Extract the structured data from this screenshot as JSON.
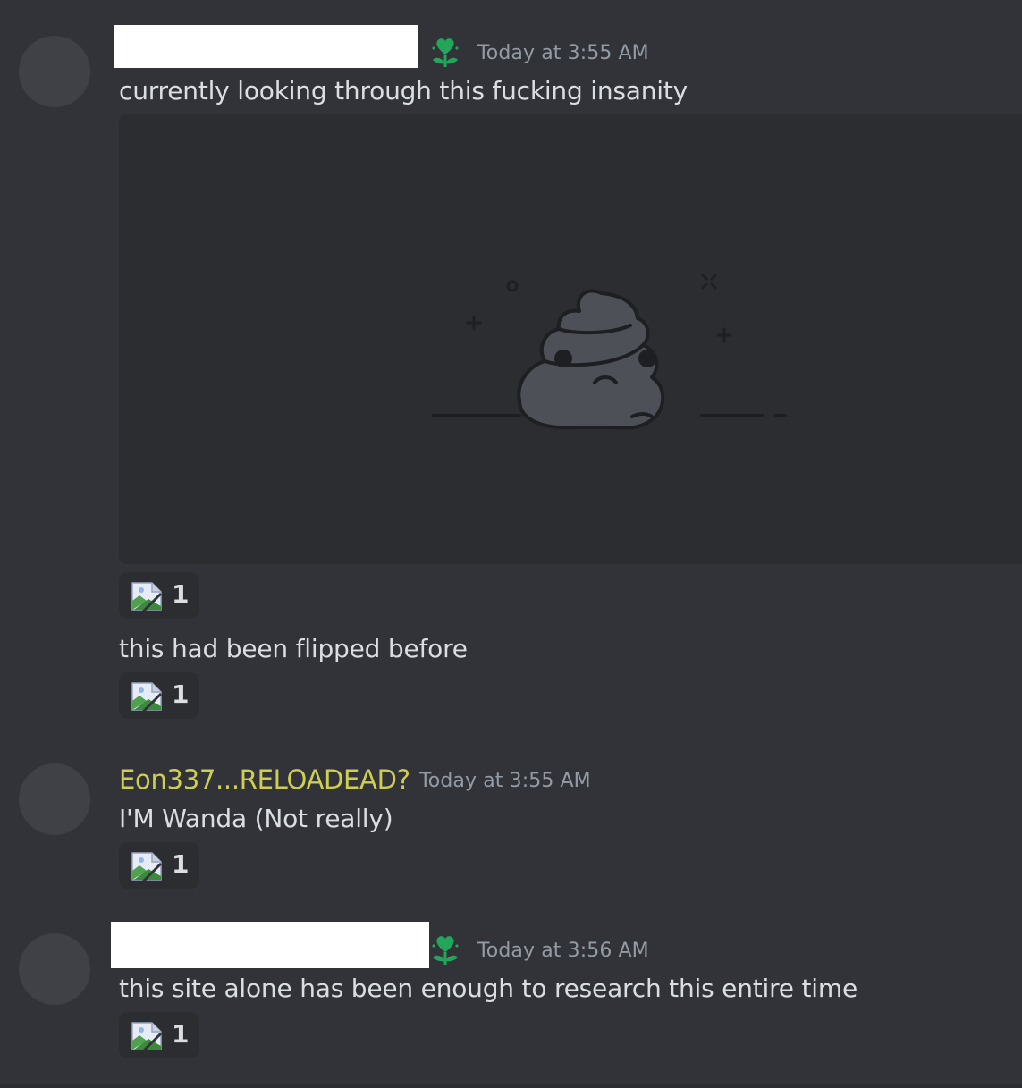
{
  "messages": [
    {
      "username": "",
      "timestamp": "Today at 3:55 AM",
      "text": "currently looking through this fucking insanity",
      "attachment": "broken-image-placeholder-icon",
      "reaction": {
        "emoji": "broken-image-icon",
        "count": "1"
      }
    },
    {
      "text": "this had been flipped before",
      "reaction": {
        "emoji": "broken-image-icon",
        "count": "1"
      }
    },
    {
      "username": "Eon337...RELOADEAD?",
      "username_color": "#cdce52",
      "timestamp": "Today at 3:55 AM",
      "text": "I'M Wanda (Not really)",
      "reaction": {
        "emoji": "broken-image-icon",
        "count": "1"
      }
    },
    {
      "username": "",
      "timestamp": "Today at 3:56 AM",
      "text": "this site alone has been enough to research this entire time",
      "reaction": {
        "emoji": "broken-image-icon",
        "count": "1"
      }
    }
  ],
  "role_icon": "green-heart-flower-icon",
  "colors": {
    "background": "#313338",
    "embed_background": "#2b2d31",
    "text": "#dbdee1",
    "timestamp": "#949ba4",
    "role_icon": "#23a55a"
  }
}
